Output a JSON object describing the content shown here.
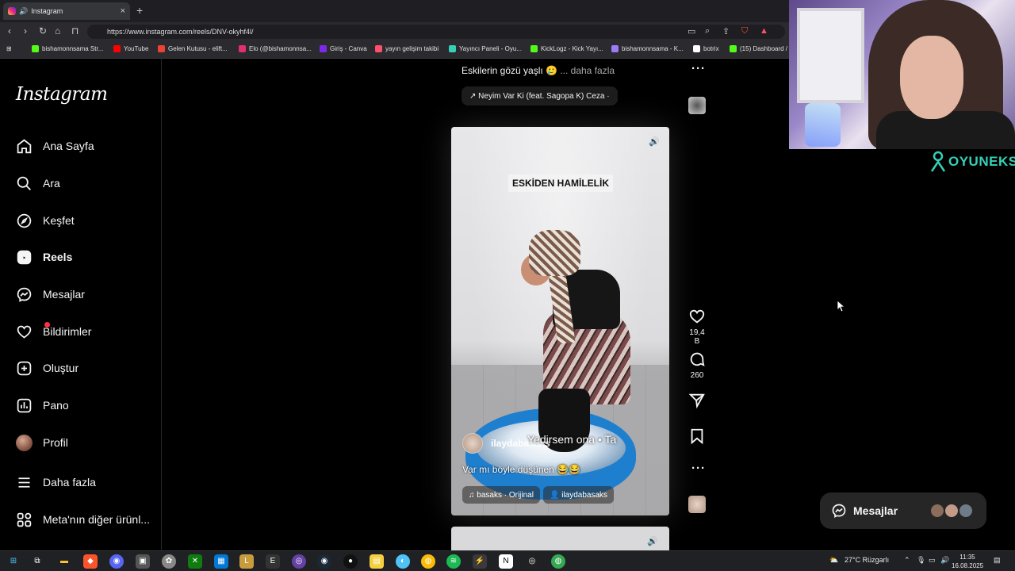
{
  "browser": {
    "tab_title": "Instagram",
    "url": "https://www.instagram.com/reels/DNV-okyhf4l/",
    "bookmarks": [
      {
        "label": "bishamonnsama Str...",
        "color": "#53fc18"
      },
      {
        "label": "YouTube",
        "color": "#ff0000"
      },
      {
        "label": "Gelen Kutusu - elift...",
        "color": "#ea4335"
      },
      {
        "label": "Elo (@bishamonnsa...",
        "color": "#e1306c"
      },
      {
        "label": "Giriş - Canva",
        "color": "#7d2ae8"
      },
      {
        "label": "yayın gelişim takibi",
        "color": "#ff4f6d"
      },
      {
        "label": "Yayıncı Paneli - Oyu...",
        "color": "#35d0b6"
      },
      {
        "label": "KickLogz - Kick Yayı...",
        "color": "#53fc18"
      },
      {
        "label": "bishamonnsama - K...",
        "color": "#9b7cf5"
      },
      {
        "label": "botrix",
        "color": "#ffffff"
      },
      {
        "label": "(15) Dashboard /",
        "color": "#53fc18"
      }
    ]
  },
  "instagram": {
    "logo": "Instagram",
    "nav": {
      "home": "Ana Sayfa",
      "search": "Ara",
      "explore": "Keşfet",
      "reels": "Reels",
      "messages": "Mesajlar",
      "notifications": "Bildirimler",
      "create": "Oluştur",
      "dashboard": "Pano",
      "profile": "Profil",
      "more": "Daha fazla",
      "meta": "Meta'nın diğer ürünl..."
    },
    "prev_reel": {
      "caption": "Eskilerin gözü yaşlı 🥲",
      "more": "... daha fazla",
      "song": "↗ Neyim Var Ki (feat. Sagopa K)  Ceza ·"
    },
    "reel": {
      "overlay_title": "ESKİDEN HAMİLELİK",
      "username": "ilaydabasaks",
      "subtitle": "Yedirsem ona  •  Ta",
      "caption": "Var mı böyle düşünen 😂😂",
      "audio": "♫ basaks · Orijinal",
      "tagged": "👤 ilaydabasaks",
      "likes": "19,4 B",
      "comments": "260"
    },
    "messages_widget": "Mesajlar"
  },
  "overlay": {
    "brand": "OYUNEKS"
  },
  "taskbar": {
    "weather": "27°C  Rüzgarlı",
    "time": "11:35",
    "date": "16.08.2025"
  }
}
